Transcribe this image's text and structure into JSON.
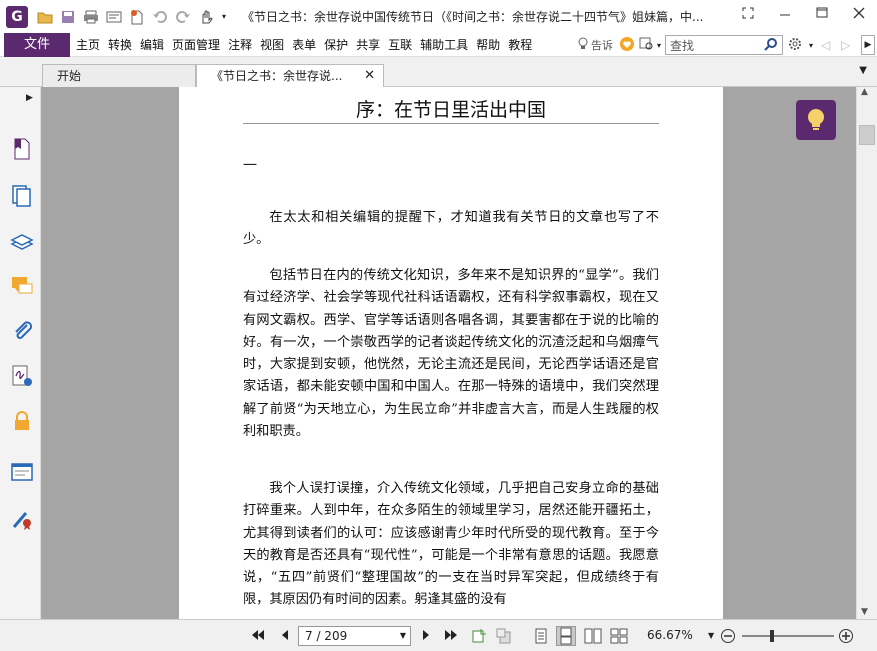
{
  "titlebar": {
    "logo_letter": "G",
    "title": "《节日之书：余世存说中国传统节日（《时间之书：余世存说二十四节气》姐妹篇，中..."
  },
  "menubar": {
    "file": "文件",
    "items": [
      "主页",
      "转换",
      "编辑",
      "页面管理",
      "注释",
      "视图",
      "表单",
      "保护",
      "共享",
      "互联",
      "辅助工具",
      "帮助",
      "教程"
    ],
    "tell": "告诉",
    "search_placeholder": "查找"
  },
  "tabs": {
    "home": "开始",
    "doc": "《节日之书：余世存说...",
    "close": "✕"
  },
  "document": {
    "title": "序：在节日里活出中国",
    "section": "一",
    "paragraphs": [
      "在太太和相关编辑的提醒下，才知道我有关节日的文章也写了不少。",
      "包括节日在内的传统文化知识，多年来不是知识界的“显学”。我们有过经济学、社会学等现代社科话语霸权，还有科学叙事霸权，现在又有网文霸权。西学、官学等话语则各唱各调，其要害都在于说的比喻的好。有一次，一个崇敬西学的记者谈起传统文化的沉渣泛起和乌烟瘴气时，大家提到安顿，他恍然，无论主流还是民间，无论西学话语还是官家话语，都未能安顿中国和中国人。在那一特殊的语境中，我们突然理解了前贤“为天地立心，为生民立命”并非虚言大言，而是人生践履的权利和职责。",
      "我个人误打误撞，介入传统文化领域，几乎把自己安身立命的基础打碎重来。人到中年，在众多陌生的领域里学习，居然还能开疆拓土，尤其得到读者们的认可：应该感谢青少年时代所受的现代教育。至于今天的教育是否还具有“现代性”，可能是一个非常有意思的话题。我愿意说，“五四”前贤们“整理国故”的一支在当时异军突起，但成绩终于有限，其原因仍有时间的因素。躬逢其盛的没有"
    ]
  },
  "statusbar": {
    "page_value": "7 / 209",
    "zoom": "66.67%"
  },
  "colors": {
    "brand": "#5b2a6e",
    "doc_bg": "#a5a5a5"
  }
}
